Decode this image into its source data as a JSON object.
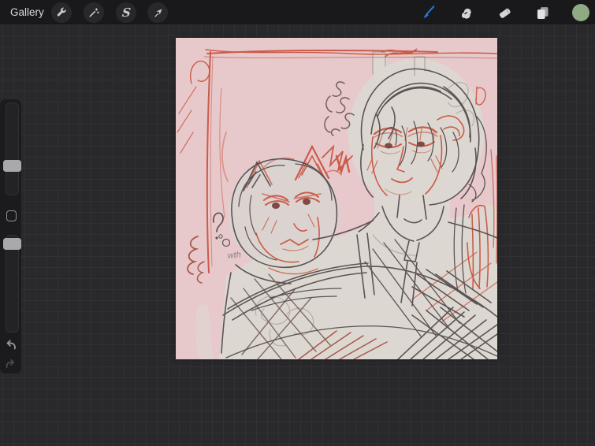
{
  "toolbar": {
    "gallery_label": "Gallery",
    "left_tools": [
      {
        "icon": "wrench-icon"
      },
      {
        "icon": "magic-wand-icon"
      },
      {
        "icon": "selection-s-icon"
      },
      {
        "icon": "transform-arrow-icon"
      }
    ],
    "right_tools": [
      {
        "icon": "paintbrush-icon",
        "state": "active",
        "color": "#2079dd"
      },
      {
        "icon": "smudge-finger-icon"
      },
      {
        "icon": "eraser-icon"
      },
      {
        "icon": "layers-icon"
      },
      {
        "icon": "color-circle",
        "color": "#8fab84"
      }
    ]
  },
  "sidebar": {
    "sliders": [
      {
        "name": "brush-size",
        "handle_position": "lower-middle"
      },
      {
        "name": "opacity",
        "handle_position": "top"
      }
    ],
    "modify_button_shape": "square",
    "undo_icon": "undo-arrow-icon",
    "redo_icon": "redo-arrow-icon"
  },
  "canvas": {
    "annotation_text": "wth",
    "background_color": "#e7c9cc",
    "subject": "rough red and charcoal sketch of two figures hugging, one with cat ears",
    "palette": {
      "sketch_red": "#cb5b49",
      "sketch_dark": "#564c4e",
      "sketch_light": "#b5aba6",
      "figure_fill": "#dcd8d1"
    }
  },
  "workspace": {
    "background_color": "#29292b",
    "grid_color": "#313134"
  }
}
